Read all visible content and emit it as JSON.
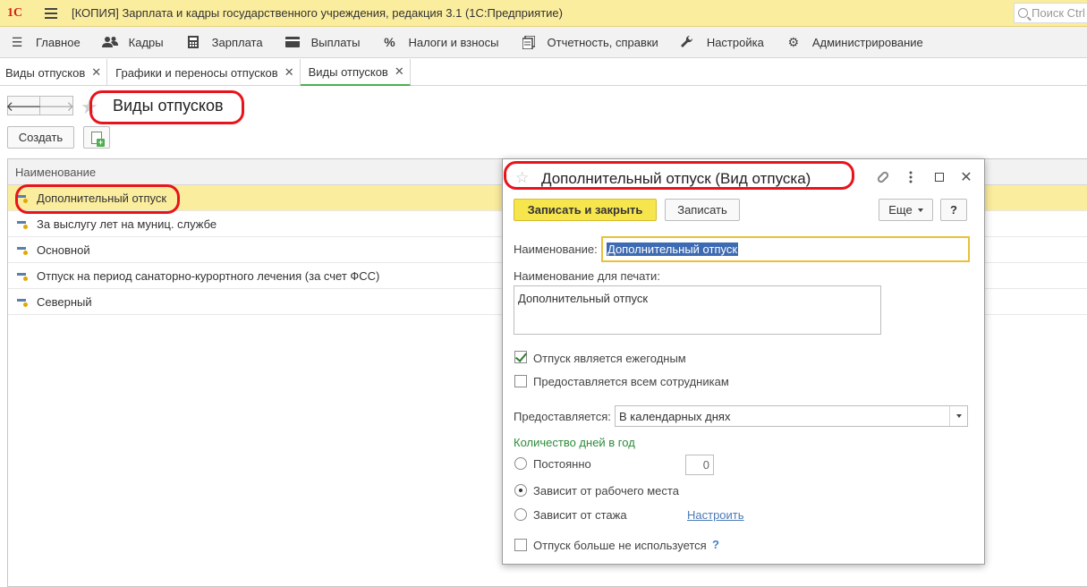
{
  "app": {
    "logo": "1С",
    "title": "[КОПИЯ] Зарплата и кадры государственного учреждения, редакция 3.1  (1С:Предприятие)",
    "search_placeholder": "Поиск Ctrl"
  },
  "menu": [
    {
      "icon": "list-icon",
      "label": "Главное"
    },
    {
      "icon": "people-icon",
      "label": "Кадры"
    },
    {
      "icon": "calculator-icon",
      "label": "Зарплата"
    },
    {
      "icon": "wallet-icon",
      "label": "Выплаты"
    },
    {
      "icon": "percent-icon",
      "label": "Налоги и взносы"
    },
    {
      "icon": "report-icon",
      "label": "Отчетность, справки"
    },
    {
      "icon": "wrench-icon",
      "label": "Настройка"
    },
    {
      "icon": "gear-icon",
      "label": "Администрирование"
    }
  ],
  "tabs": [
    {
      "label": "Виды отпусков",
      "active": false
    },
    {
      "label": "Графики и переносы отпусков",
      "active": false
    },
    {
      "label": "Виды отпусков",
      "active": true
    }
  ],
  "page": {
    "title": "Виды отпусков",
    "create_label": "Создать"
  },
  "list": {
    "header": "Наименование",
    "rows": [
      "Дополнительный отпуск",
      "За выслугу лет на муниц. службе",
      "Основной",
      "Отпуск на период санаторно-курортного лечения (за счет ФСС)",
      "Северный"
    ],
    "selected_index": 0
  },
  "dialog": {
    "title": "Дополнительный отпуск (Вид отпуска)",
    "save_close_label": "Записать и закрыть",
    "save_label": "Записать",
    "more_label": "Еще",
    "help_label": "?",
    "name_label": "Наименование:",
    "name_value": "Дополнительный отпуск",
    "print_label": "Наименование для печати:",
    "print_value": "Дополнительный отпуск",
    "annual_label": "Отпуск является ежегодным",
    "annual_checked": true,
    "all_employees_label": "Предоставляется всем сотрудникам",
    "all_employees_checked": false,
    "provided_label": "Предоставляется:",
    "provided_value": "В календарных днях",
    "days_group_title": "Количество дней в год",
    "radio_constant": "Постоянно",
    "constant_days": "0",
    "radio_workplace": "Зависит от рабочего места",
    "radio_seniority": "Зависит от стажа",
    "configure_link": "Настроить",
    "not_used_label": "Отпуск больше не используется",
    "not_used_help": "?"
  },
  "colors": {
    "titlebar": "#fbed9e",
    "selected_row": "#fbed9e",
    "primary_button": "#f7e54e",
    "highlight_marker": "#e8141b",
    "group_title": "#2e8b3a",
    "link": "#4a7bb7"
  }
}
